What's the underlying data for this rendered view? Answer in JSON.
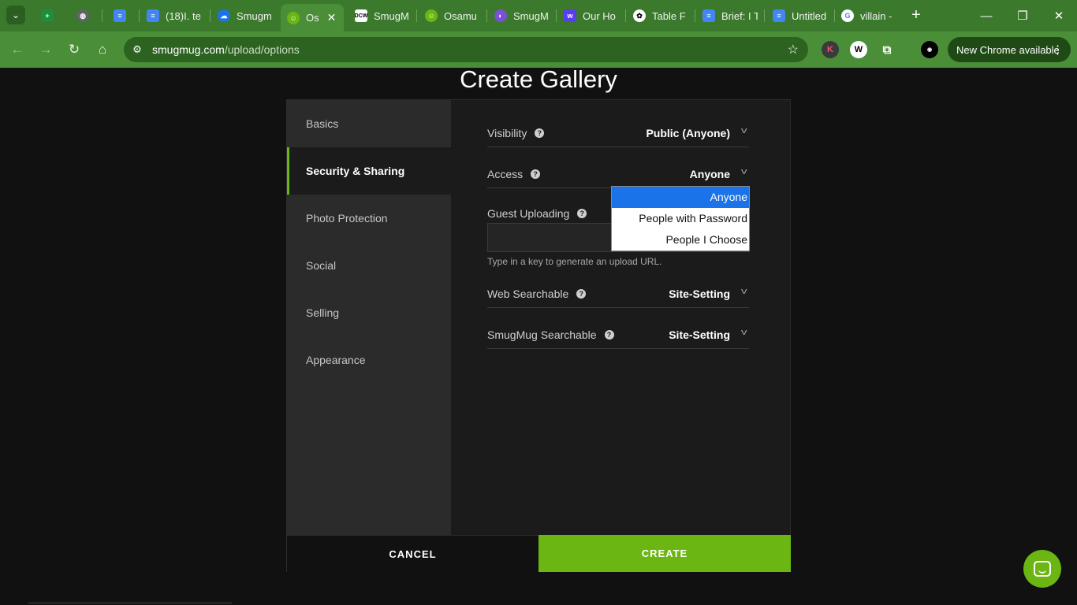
{
  "browser": {
    "tabs": [
      {
        "title": "",
        "icon": "sheets-icon",
        "color": "#1e8e3e"
      },
      {
        "title": "",
        "icon": "globe-icon",
        "color": "#5f6368"
      },
      {
        "title": "",
        "icon": "docs-icon",
        "color": "#4285f4"
      },
      {
        "title": "(18)I. te",
        "icon": "docs-icon",
        "color": "#4285f4"
      },
      {
        "title": "Smugm",
        "icon": "cloud-icon",
        "color": "#1a73e8"
      },
      {
        "title": "Os",
        "icon": "smugmug-icon",
        "color": "#6bb613",
        "active": true
      },
      {
        "title": "SmugM",
        "icon": "dcw-icon",
        "color": "#ffffff"
      },
      {
        "title": "Osamu",
        "icon": "smugmug-icon",
        "color": "#6bb613"
      },
      {
        "title": "SmugM",
        "icon": "planet-icon",
        "color": "#7b4fd6"
      },
      {
        "title": "Our Ho",
        "icon": "w-logo-icon",
        "color": "#5a3df0"
      },
      {
        "title": "Table F",
        "icon": "openai-icon",
        "color": "#ffffff"
      },
      {
        "title": "Brief: I T",
        "icon": "docs-icon",
        "color": "#4285f4"
      },
      {
        "title": "Untitled",
        "icon": "docs-icon",
        "color": "#4285f4"
      },
      {
        "title": "villain -",
        "icon": "google-icon",
        "color": "#ffffff"
      }
    ],
    "url_host": "smugmug.com",
    "url_path": "/upload/options",
    "update_label": "New Chrome available"
  },
  "page": {
    "title": "Create Gallery",
    "sidenav": [
      "Basics",
      "Security & Sharing",
      "Photo Protection",
      "Social",
      "Selling",
      "Appearance"
    ],
    "active_section": "Security & Sharing",
    "fields": {
      "visibility": {
        "label": "Visibility",
        "value": "Public (Anyone)"
      },
      "access": {
        "label": "Access",
        "value": "Anyone"
      },
      "guest_uploading": {
        "label": "Guest Uploading",
        "value": "",
        "hint": "Type in a key to generate an upload URL."
      },
      "web_searchable": {
        "label": "Web Searchable",
        "value": "Site-Setting"
      },
      "smugmug_searchable": {
        "label": "SmugMug Searchable",
        "value": "Site-Setting"
      }
    },
    "access_options": [
      "Anyone",
      "People with Password",
      "People I Choose"
    ],
    "access_selected": "Anyone",
    "cancel_label": "CANCEL",
    "create_label": "CREATE",
    "accent_color": "#6bb613"
  }
}
